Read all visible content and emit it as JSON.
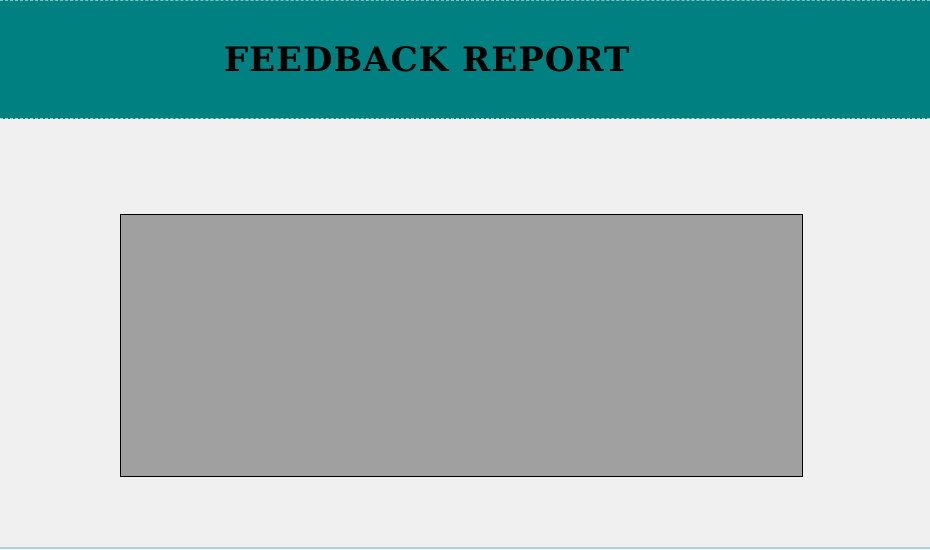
{
  "header": {
    "title": "FEEDBACK REPORT"
  },
  "colors": {
    "header_background": "#008080",
    "window_background": "#f0f0f0",
    "panel_background": "#a0a0a0",
    "title_text": "#000000"
  }
}
